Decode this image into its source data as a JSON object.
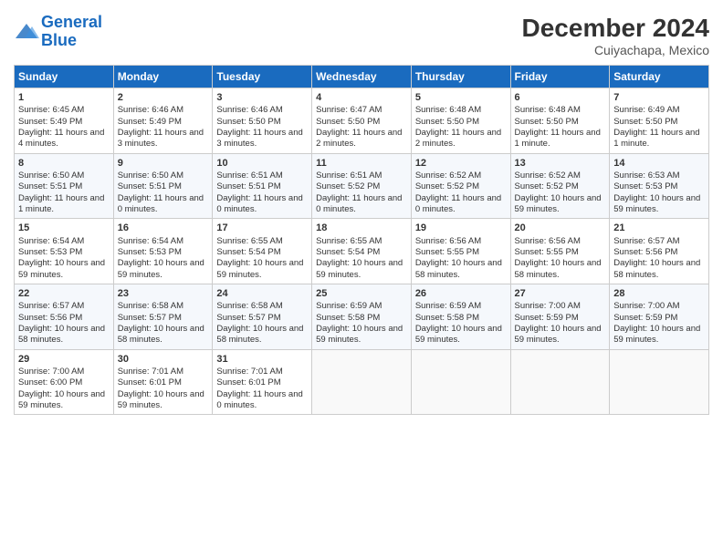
{
  "logo": {
    "line1": "General",
    "line2": "Blue"
  },
  "title": "December 2024",
  "subtitle": "Cuiyachapa, Mexico",
  "headers": [
    "Sunday",
    "Monday",
    "Tuesday",
    "Wednesday",
    "Thursday",
    "Friday",
    "Saturday"
  ],
  "weeks": [
    [
      {
        "day": 1,
        "sunrise": "6:45 AM",
        "sunset": "5:49 PM",
        "daylight": "11 hours and 4 minutes."
      },
      {
        "day": 2,
        "sunrise": "6:46 AM",
        "sunset": "5:49 PM",
        "daylight": "11 hours and 3 minutes."
      },
      {
        "day": 3,
        "sunrise": "6:46 AM",
        "sunset": "5:50 PM",
        "daylight": "11 hours and 3 minutes."
      },
      {
        "day": 4,
        "sunrise": "6:47 AM",
        "sunset": "5:50 PM",
        "daylight": "11 hours and 2 minutes."
      },
      {
        "day": 5,
        "sunrise": "6:48 AM",
        "sunset": "5:50 PM",
        "daylight": "11 hours and 2 minutes."
      },
      {
        "day": 6,
        "sunrise": "6:48 AM",
        "sunset": "5:50 PM",
        "daylight": "11 hours and 1 minute."
      },
      {
        "day": 7,
        "sunrise": "6:49 AM",
        "sunset": "5:50 PM",
        "daylight": "11 hours and 1 minute."
      }
    ],
    [
      {
        "day": 8,
        "sunrise": "6:50 AM",
        "sunset": "5:51 PM",
        "daylight": "11 hours and 1 minute."
      },
      {
        "day": 9,
        "sunrise": "6:50 AM",
        "sunset": "5:51 PM",
        "daylight": "11 hours and 0 minutes."
      },
      {
        "day": 10,
        "sunrise": "6:51 AM",
        "sunset": "5:51 PM",
        "daylight": "11 hours and 0 minutes."
      },
      {
        "day": 11,
        "sunrise": "6:51 AM",
        "sunset": "5:52 PM",
        "daylight": "11 hours and 0 minutes."
      },
      {
        "day": 12,
        "sunrise": "6:52 AM",
        "sunset": "5:52 PM",
        "daylight": "11 hours and 0 minutes."
      },
      {
        "day": 13,
        "sunrise": "6:52 AM",
        "sunset": "5:52 PM",
        "daylight": "10 hours and 59 minutes."
      },
      {
        "day": 14,
        "sunrise": "6:53 AM",
        "sunset": "5:53 PM",
        "daylight": "10 hours and 59 minutes."
      }
    ],
    [
      {
        "day": 15,
        "sunrise": "6:54 AM",
        "sunset": "5:53 PM",
        "daylight": "10 hours and 59 minutes."
      },
      {
        "day": 16,
        "sunrise": "6:54 AM",
        "sunset": "5:53 PM",
        "daylight": "10 hours and 59 minutes."
      },
      {
        "day": 17,
        "sunrise": "6:55 AM",
        "sunset": "5:54 PM",
        "daylight": "10 hours and 59 minutes."
      },
      {
        "day": 18,
        "sunrise": "6:55 AM",
        "sunset": "5:54 PM",
        "daylight": "10 hours and 59 minutes."
      },
      {
        "day": 19,
        "sunrise": "6:56 AM",
        "sunset": "5:55 PM",
        "daylight": "10 hours and 58 minutes."
      },
      {
        "day": 20,
        "sunrise": "6:56 AM",
        "sunset": "5:55 PM",
        "daylight": "10 hours and 58 minutes."
      },
      {
        "day": 21,
        "sunrise": "6:57 AM",
        "sunset": "5:56 PM",
        "daylight": "10 hours and 58 minutes."
      }
    ],
    [
      {
        "day": 22,
        "sunrise": "6:57 AM",
        "sunset": "5:56 PM",
        "daylight": "10 hours and 58 minutes."
      },
      {
        "day": 23,
        "sunrise": "6:58 AM",
        "sunset": "5:57 PM",
        "daylight": "10 hours and 58 minutes."
      },
      {
        "day": 24,
        "sunrise": "6:58 AM",
        "sunset": "5:57 PM",
        "daylight": "10 hours and 58 minutes."
      },
      {
        "day": 25,
        "sunrise": "6:59 AM",
        "sunset": "5:58 PM",
        "daylight": "10 hours and 59 minutes."
      },
      {
        "day": 26,
        "sunrise": "6:59 AM",
        "sunset": "5:58 PM",
        "daylight": "10 hours and 59 minutes."
      },
      {
        "day": 27,
        "sunrise": "7:00 AM",
        "sunset": "5:59 PM",
        "daylight": "10 hours and 59 minutes."
      },
      {
        "day": 28,
        "sunrise": "7:00 AM",
        "sunset": "5:59 PM",
        "daylight": "10 hours and 59 minutes."
      }
    ],
    [
      {
        "day": 29,
        "sunrise": "7:00 AM",
        "sunset": "6:00 PM",
        "daylight": "10 hours and 59 minutes."
      },
      {
        "day": 30,
        "sunrise": "7:01 AM",
        "sunset": "6:01 PM",
        "daylight": "10 hours and 59 minutes."
      },
      {
        "day": 31,
        "sunrise": "7:01 AM",
        "sunset": "6:01 PM",
        "daylight": "11 hours and 0 minutes."
      },
      null,
      null,
      null,
      null
    ]
  ]
}
